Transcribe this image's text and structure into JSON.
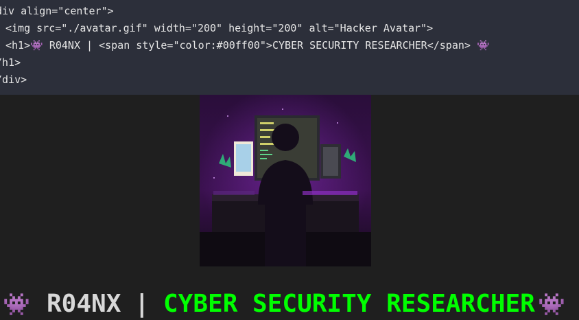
{
  "code": {
    "lines": [
      "div align=\"center\">",
      "<img src=\"./avatar.gif\" width=\"200\" height=\"200\" alt=\"Hacker Avatar\">",
      "<h1>👾 R04NX | <span style=\"color:#00ff00\">CYBER SECURITY RESEARCHER</span> 👾",
      "/h1>",
      "/div>"
    ]
  },
  "avatar": {
    "alt": "Hacker Avatar"
  },
  "heading": {
    "invader_left": "👾",
    "name": "R04NX",
    "separator": "|",
    "role": "CYBER SECURITY RESEARCHER",
    "invader_right": "👾",
    "role_color": "#00ff00"
  },
  "colors": {
    "code_bg": "#2c2f3a",
    "page_bg": "#1f1f1f",
    "accent": "#00ff00"
  }
}
